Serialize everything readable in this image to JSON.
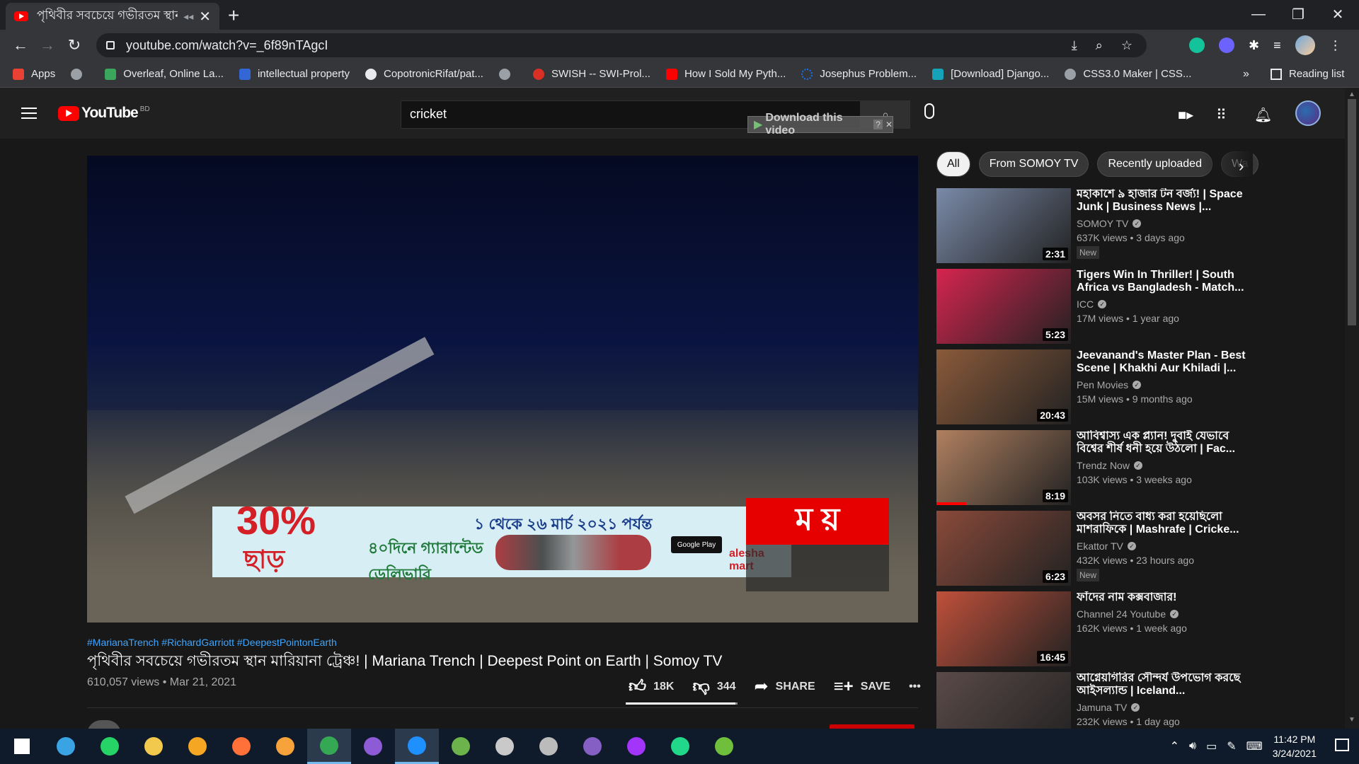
{
  "browser": {
    "tab_title": "পৃথিবীর সবচেয়ে গভীরতম স্থান",
    "url": "youtube.com/watch?v=_6f89nTAgcI",
    "bookmarks": [
      {
        "label": "Apps",
        "color": "#e94235"
      },
      {
        "label": "",
        "color": "#9aa0a6"
      },
      {
        "label": "Overleaf, Online La...",
        "color": "#3ba75d"
      },
      {
        "label": "intellectual property",
        "color": "#3367d6"
      },
      {
        "label": "CopotronicRifat/pat...",
        "color": "#e8eaed"
      },
      {
        "label": "",
        "color": "#9aa0a6"
      },
      {
        "label": "SWISH -- SWI-Prol...",
        "color": "#d93025"
      },
      {
        "label": "How I Sold My Pyth...",
        "color": "#ff0000"
      },
      {
        "label": "Josephus Problem...",
        "color": "#1a73e8"
      },
      {
        "label": "[Download] Django...",
        "color": "#16a2b8"
      },
      {
        "label": "CSS3.0 Maker | CSS...",
        "color": "#9aa0a6"
      }
    ],
    "bookmarks_more": "»",
    "reading_list": "Reading list"
  },
  "youtube": {
    "logo_text": "YouTube",
    "country_code": "BD",
    "search_value": "cricket",
    "download_label": "Download this video",
    "download_q": "?"
  },
  "video": {
    "hashtags": "#MarianaTrench #RichardGarriott #DeepestPointonEarth",
    "title": "পৃথিবীর সবচেয়ে গভীরতম স্থান মারিয়ানা ট্রেঞ্চ! | Mariana Trench | Deepest Point on Earth | Somoy TV",
    "views_date": "610,057 views • Mar 21, 2021",
    "likes": "18K",
    "dislikes": "344",
    "share": "SHARE",
    "save": "SAVE",
    "more": "•••",
    "like_ratio": 0.98
  },
  "ad": {
    "percent": "30%",
    "off": "ছাড়",
    "dates": "১ থেকে ২৬ মার্চ ২০২১ পর্যন্ত",
    "delivery": "৪০দিনে গ্যারান্টেড ডেলিভারি",
    "gplay": "Google Play",
    "brand": "alesha mart",
    "close": "ⓘ ✕"
  },
  "somoy_logo": "ম য়",
  "chips": [
    "All",
    "From SOMOY TV",
    "Recently uploaded",
    "Wa"
  ],
  "recommendations": [
    {
      "title": "মহাকাশে ৯ হাজার টন বর্জ্য! | Space Junk | Business News |...",
      "channel": "SOMOY TV",
      "meta": "637K views • 3 days ago",
      "badge": "New",
      "duration": "2:31",
      "thumb_color": "#7a8aa8",
      "watched": 0
    },
    {
      "title": "Tigers Win In Thriller! | South Africa vs Bangladesh - Match...",
      "channel": "ICC",
      "meta": "17M views • 1 year ago",
      "badge": "",
      "duration": "5:23",
      "thumb_color": "#d6244f",
      "watched": 0
    },
    {
      "title": "Jeevanand's Master Plan - Best Scene | Khakhi Aur Khiladi |...",
      "channel": "Pen Movies",
      "meta": "15M views • 9 months ago",
      "badge": "",
      "duration": "20:43",
      "thumb_color": "#8a5a3a",
      "watched": 0
    },
    {
      "title": "আবিশ্বাস্য এক প্ল্যান! দুবাই যেভাবে বিশ্বের শীর্ষ ধনী হয়ে উঠলো | Fac...",
      "channel": "Trendz Now",
      "meta": "103K views • 3 weeks ago",
      "badge": "",
      "duration": "8:19",
      "thumb_color": "#b08060",
      "watched": 0.22
    },
    {
      "title": "অবসর নিতে বাধ্য করা হয়েছিলো মাশরাফিকে | Mashrafe | Cricke...",
      "channel": "Ekattor TV",
      "meta": "432K views • 23 hours ago",
      "badge": "New",
      "duration": "6:23",
      "thumb_color": "#8a4a3a",
      "watched": 0
    },
    {
      "title": "ফাঁদের নাম কক্সবাজার!",
      "channel": "Channel 24 Youtube",
      "meta": "162K views • 1 week ago",
      "badge": "",
      "duration": "16:45",
      "thumb_color": "#c0503a",
      "watched": 0
    },
    {
      "title": "আগ্নেয়গিরির সৌন্দর্য উপভোগ করছে আইসল্যান্ড | Iceland...",
      "channel": "Jamuna TV",
      "meta": "232K views • 1 day ago",
      "badge": "",
      "duration": "",
      "thumb_color": "#5a4a48",
      "watched": 0
    }
  ],
  "taskbar": {
    "apps": [
      {
        "name": "windows-start-icon",
        "color": "#ffffff"
      },
      {
        "name": "refresh-app-icon",
        "color": "#3aa3e3"
      },
      {
        "name": "whatsapp-icon",
        "color": "#25d366"
      },
      {
        "name": "file-explorer-icon",
        "color": "#f2c94c"
      },
      {
        "name": "app-shield-icon",
        "color": "#f5a623"
      },
      {
        "name": "firefox-icon",
        "color": "#ff7139"
      },
      {
        "name": "app-orange-icon",
        "color": "#f7a23b"
      },
      {
        "name": "chrome-icon",
        "color": "#34a853"
      },
      {
        "name": "github-desktop-icon",
        "color": "#8e5bd6"
      },
      {
        "name": "vscode-icon",
        "color": "#1e90ff"
      },
      {
        "name": "app-globe-icon",
        "color": "#6bb34a"
      },
      {
        "name": "app-gear-icon",
        "color": "#c9c9c9"
      },
      {
        "name": "app-satellite-icon",
        "color": "#bbbbbb"
      },
      {
        "name": "visual-studio-icon",
        "color": "#865fc5"
      },
      {
        "name": "messenger-icon",
        "color": "#a334fa"
      },
      {
        "name": "pycharm-icon",
        "color": "#21d789"
      },
      {
        "name": "app-green-icon",
        "color": "#6fbf3c"
      }
    ],
    "time": "11:42 PM",
    "date": "3/24/2021"
  }
}
